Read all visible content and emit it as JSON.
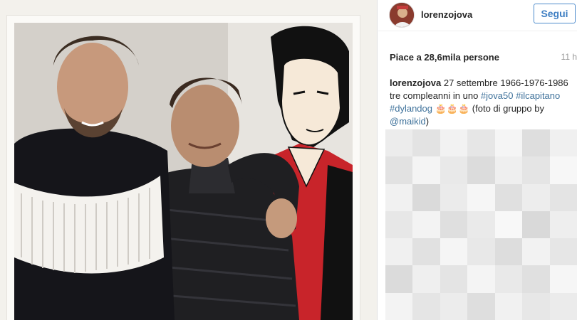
{
  "post": {
    "username": "lorenzojova",
    "follow_label": "Segui",
    "likes": "Piace a 28,6mila persone",
    "time": "11 h",
    "caption": {
      "user": "lorenzojova",
      "text1": " 27 settembre 1966-1976-1986 tre compleanni in uno ",
      "tag1": "#jova50",
      "tag2": "#ilcapitano",
      "tag3": "#dylandog",
      "text2": " 🎂🎂🎂 (foto di gruppo by ",
      "mention": "@maikid",
      "text3": ")"
    }
  },
  "colors": {
    "link": "#3f729b",
    "follow_border": "#4e8ccc"
  },
  "icons": {
    "avatar": "profile-photo"
  }
}
